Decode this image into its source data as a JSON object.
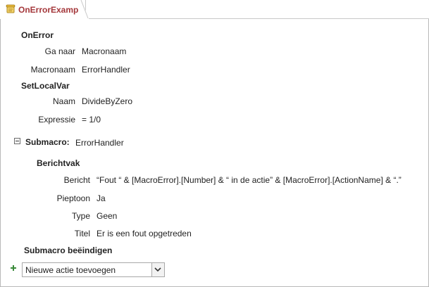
{
  "tab": {
    "title": "OnErrorExample"
  },
  "actions": {
    "onerror": {
      "heading": "OnError",
      "ganaar_label": "Ga naar",
      "ganaar_value": "Macronaam",
      "macronaam_label": "Macronaam",
      "macronaam_value": "ErrorHandler"
    },
    "setlocalvar": {
      "heading": "SetLocalVar",
      "naam_label": "Naam",
      "naam_value": "DivideByZero",
      "expressie_label": "Expressie",
      "expressie_value": "= 1/0"
    }
  },
  "submacro": {
    "label": "Submacro:",
    "name": "ErrorHandler",
    "berichtvak": {
      "heading": "Berichtvak",
      "bericht_label": "Bericht",
      "bericht_value": "“Fout “ & [MacroError].[Number] & “ in de actie” & [MacroError].[ActionName] & “.”",
      "pieptoon_label": "Pieptoon",
      "pieptoon_value": "Ja",
      "type_label": "Type",
      "type_value": "Geen",
      "titel_label": "Titel",
      "titel_value": "Er is een fout opgetreden"
    },
    "end_label": "Submacro beëindigen"
  },
  "add_action": {
    "value": "Nieuwe actie toevoegen",
    "icon": "plus-icon",
    "icon_color": "#3a8a3a"
  },
  "colors": {
    "tab_title": "#a4373a"
  }
}
